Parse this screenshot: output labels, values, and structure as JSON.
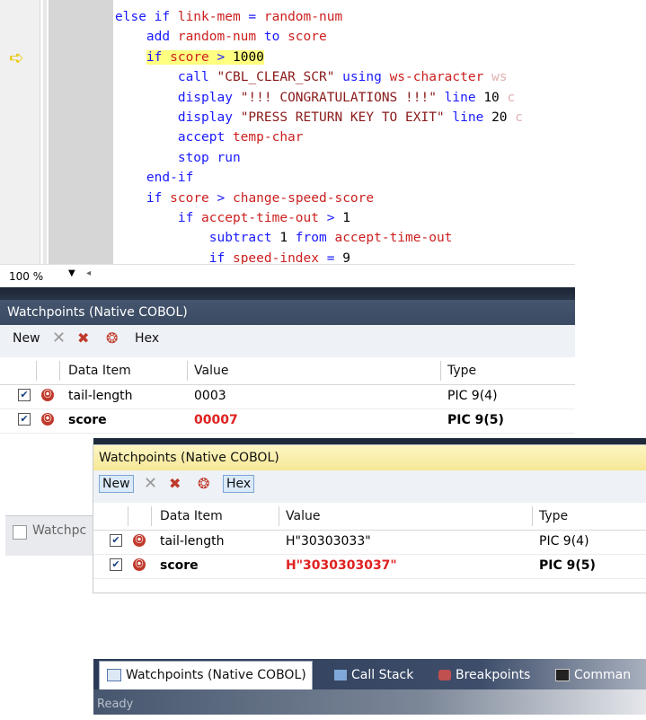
{
  "editor": {
    "lines": [
      {
        "indent": 0,
        "tokens": [
          [
            "kw",
            "else if "
          ],
          [
            "id",
            "link-mem"
          ],
          [
            "kw",
            " = "
          ],
          [
            "id",
            "random-num"
          ]
        ]
      },
      {
        "indent": 1,
        "tokens": [
          [
            "kw",
            "add "
          ],
          [
            "id",
            "random-num"
          ],
          [
            "kw",
            " to "
          ],
          [
            "id",
            "score"
          ]
        ]
      },
      {
        "indent": 1,
        "highlight": true,
        "tokens": [
          [
            "kw",
            "if "
          ],
          [
            "id",
            "score"
          ],
          [
            "kw",
            " > "
          ],
          [
            "nm",
            "1000"
          ]
        ]
      },
      {
        "indent": 2,
        "tokens": [
          [
            "kw",
            "call "
          ],
          [
            "st",
            "\"CBL_CLEAR_SCR\""
          ],
          [
            "kw",
            " using "
          ],
          [
            "id",
            "ws-character"
          ],
          [
            "dim",
            " ws"
          ]
        ]
      },
      {
        "indent": 2,
        "tokens": [
          [
            "kw",
            "display "
          ],
          [
            "st",
            "\"!!! CONGRATULATIONS !!!\""
          ],
          [
            "kw",
            " line "
          ],
          [
            "nm",
            "10"
          ],
          [
            "dim",
            " c"
          ]
        ]
      },
      {
        "indent": 2,
        "tokens": [
          [
            "kw",
            "display "
          ],
          [
            "st",
            "\"PRESS RETURN KEY TO EXIT\""
          ],
          [
            "kw",
            " line "
          ],
          [
            "nm",
            "20"
          ],
          [
            "dim",
            " c"
          ]
        ]
      },
      {
        "indent": 2,
        "tokens": [
          [
            "kw",
            "accept "
          ],
          [
            "id",
            "temp-char"
          ]
        ]
      },
      {
        "indent": 2,
        "tokens": [
          [
            "kw",
            "stop run"
          ]
        ]
      },
      {
        "indent": 1,
        "tokens": [
          [
            "kw",
            "end-if"
          ]
        ]
      },
      {
        "indent": 1,
        "tokens": [
          [
            "kw",
            "if "
          ],
          [
            "id",
            "score"
          ],
          [
            "kw",
            " > "
          ],
          [
            "id",
            "change-speed-score"
          ]
        ]
      },
      {
        "indent": 2,
        "tokens": [
          [
            "kw",
            "if "
          ],
          [
            "id",
            "accept-time-out"
          ],
          [
            "kw",
            " > "
          ],
          [
            "nm",
            "1"
          ]
        ]
      },
      {
        "indent": 3,
        "tokens": [
          [
            "kw",
            "subtract "
          ],
          [
            "nm",
            "1"
          ],
          [
            "kw",
            " from "
          ],
          [
            "id",
            "accept-time-out"
          ]
        ]
      },
      {
        "indent": 3,
        "tokens": [
          [
            "kw",
            "if "
          ],
          [
            "id",
            "speed-index"
          ],
          [
            "kw",
            " = "
          ],
          [
            "nm",
            "9"
          ]
        ]
      }
    ],
    "zoom": "100 %"
  },
  "watch1": {
    "title": "Watchpoints (Native COBOL)",
    "toolbar": {
      "new": "New",
      "hex": "Hex"
    },
    "columns": {
      "data_item": "Data Item",
      "value": "Value",
      "type": "Type"
    },
    "rows": [
      {
        "name": "tail-length",
        "value": "0003",
        "type": "PIC 9(4)",
        "changed": false
      },
      {
        "name": "score",
        "value": "00007",
        "type": "PIC 9(5)",
        "changed": true
      }
    ]
  },
  "watch2": {
    "title": "Watchpoints (Native COBOL)",
    "toolbar": {
      "new": "New",
      "hex": "Hex"
    },
    "columns": {
      "data_item": "Data Item",
      "value": "Value",
      "type": "Type"
    },
    "rows": [
      {
        "name": "tail-length",
        "value": "H\"30303033\"",
        "type": "PIC 9(4)",
        "changed": false
      },
      {
        "name": "score",
        "value": "H\"3030303037\"",
        "type": "PIC 9(5)",
        "changed": true
      }
    ]
  },
  "background_tab": {
    "label": "Watchpc"
  },
  "bottom_tabs": [
    {
      "label": "Watchpoints (Native COBOL)",
      "selected": true,
      "icon": "watch-icon"
    },
    {
      "label": "Call Stack",
      "selected": false,
      "icon": "call-stack-icon"
    },
    {
      "label": "Breakpoints",
      "selected": false,
      "icon": "breakpoints-icon"
    },
    {
      "label": "Comman",
      "selected": false,
      "icon": "command-window-icon"
    }
  ],
  "status": {
    "text": "Ready"
  },
  "colors": {
    "changed_value": "#e02020",
    "keyword": "#1a1aff",
    "identifier": "#cc1f1f",
    "current_line": "#ffff80"
  }
}
